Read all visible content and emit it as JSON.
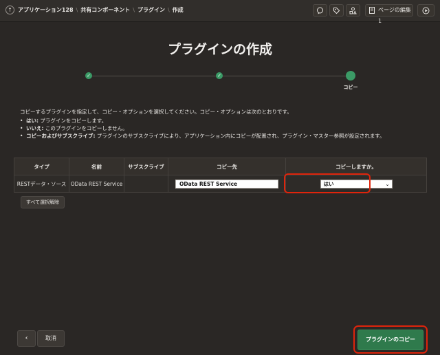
{
  "breadcrumb": {
    "items": [
      "アプリケーション128",
      "共有コンポーネント",
      "プラグイン",
      "作成"
    ]
  },
  "toolbar": {
    "edit_page_label": "ページの編集 1",
    "icons": [
      "up-arrow-icon",
      "comment-icon",
      "tag-icon",
      "shapes-icon",
      "edit-page-icon",
      "run-icon"
    ]
  },
  "page": {
    "title": "プラグインの作成"
  },
  "wizard": {
    "steps": [
      {
        "state": "done",
        "label": ""
      },
      {
        "state": "done",
        "label": ""
      },
      {
        "state": "current",
        "label": "コピー"
      }
    ]
  },
  "instructions": {
    "intro": "コピーするプラグインを指定して、コピー・オプションを選択してください。コピー・オプションは次のとおりです。",
    "options": [
      {
        "term": "はい:",
        "text": " プラグインをコピーします。"
      },
      {
        "term": "いいえ:",
        "text": " このプラグインをコピーしません。"
      },
      {
        "term": "コピーおよびサブスクライブ:",
        "text": " プラグインのサブスクライブにより、アプリケーション内にコピーが配置され、プラグイン・マスター参照が設定されます。"
      }
    ]
  },
  "table": {
    "headers": [
      "タイプ",
      "名前",
      "サブスクライブ",
      "コピー先",
      "コピーしますか。"
    ],
    "rows": [
      {
        "type": "RESTデータ・ソース",
        "name": "OData REST Service",
        "subscribe": "",
        "target": "OData REST Service",
        "copy": "はい"
      }
    ]
  },
  "buttons": {
    "unselect_all": "すべて選択解除",
    "back": "‹",
    "cancel": "取消",
    "copy_plugin": "プラグインのコピー"
  },
  "colors": {
    "background": "#2a2725",
    "accent_green": "#2f7a4c",
    "step_green": "#3b9a66",
    "highlight_red": "#e0240b"
  }
}
